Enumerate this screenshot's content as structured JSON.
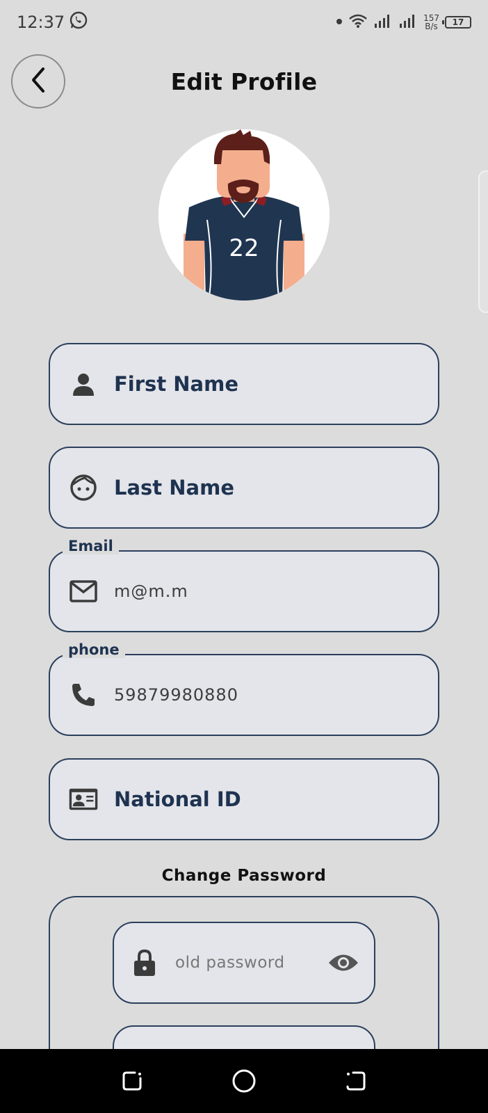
{
  "status_bar": {
    "time": "12:37",
    "speed_value": "157",
    "speed_unit": "B/s",
    "battery": "17"
  },
  "header": {
    "title": "Edit Profile"
  },
  "avatar": {
    "jersey_number": "22"
  },
  "fields": {
    "first_name": {
      "label": "First Name"
    },
    "last_name": {
      "label": "Last Name"
    },
    "email": {
      "label": "Email",
      "value": "m@m.m"
    },
    "phone": {
      "label": "phone",
      "value": "59879980880"
    },
    "national_id": {
      "label": "National ID"
    }
  },
  "password": {
    "section_title": "Change Password",
    "old_placeholder": "old password"
  },
  "colors": {
    "background": "#dcdcdc",
    "field_bg": "#e4e5ea",
    "accent": "#1e3350",
    "border": "#2b3f5c"
  }
}
